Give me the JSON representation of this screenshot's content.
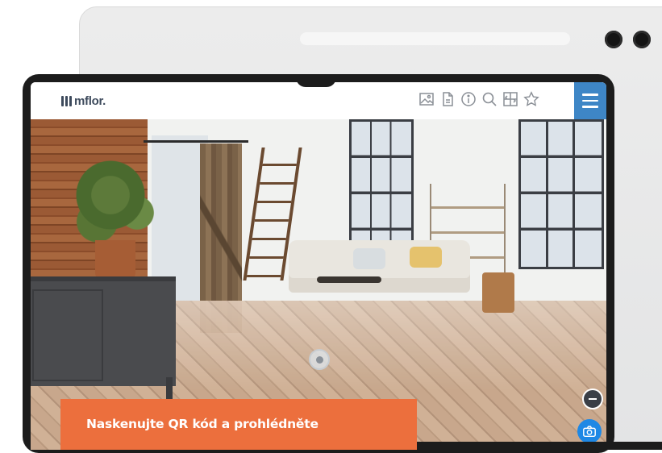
{
  "app": {
    "logo_text": "mflor.",
    "toolbar_icons": [
      "image-icon",
      "document-icon",
      "info-icon",
      "search-icon",
      "layout-icon",
      "star-icon",
      "menu-icon"
    ]
  },
  "banner": {
    "text": "Naskenujte QR kód a prohlédněte"
  },
  "colors": {
    "banner": "#ec6f3d",
    "menu_button": "#3e86c6",
    "camera_button": "#1e88e5"
  }
}
